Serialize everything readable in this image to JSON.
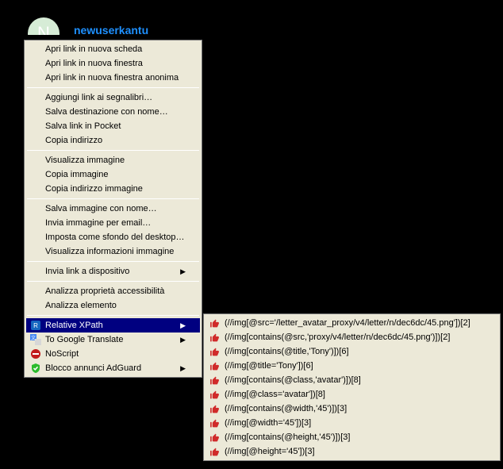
{
  "header": {
    "avatar_letter": "N",
    "username": "newuserkantu"
  },
  "menu": {
    "group1": [
      "Apri link in nuova scheda",
      "Apri link in nuova finestra",
      "Apri link in nuova finestra anonima"
    ],
    "group2": [
      "Aggiungi link ai segnalibri…",
      "Salva destinazione con nome…",
      "Salva link in Pocket",
      "Copia indirizzo"
    ],
    "group3": [
      "Visualizza immagine",
      "Copia immagine",
      "Copia indirizzo immagine"
    ],
    "group4": [
      "Salva immagine con nome…",
      "Invia immagine per email…",
      "Imposta come sfondo del desktop…",
      "Visualizza informazioni immagine"
    ],
    "group5_sub": "Invia link a dispositivo",
    "group6": [
      "Analizza proprietà accessibilità",
      "Analizza elemento"
    ],
    "ext": {
      "relxpath": "Relative XPath",
      "gtranslate": "To Google Translate",
      "noscript": "NoScript",
      "adguard": "Blocco annunci AdGuard"
    }
  },
  "submenu": [
    "(//img[@src='/letter_avatar_proxy/v4/letter/n/dec6dc/45.png'])[2]",
    "(//img[contains(@src,'proxy/v4/letter/n/dec6dc/45.png')])[2]",
    "(//img[contains(@title,'Tony')])[6]",
    "(//img[@title='Tony'])[6]",
    "(//img[contains(@class,'avatar')])[8]",
    "(//img[@class='avatar'])[8]",
    "(//img[contains(@width,'45')])[3]",
    "(//img[@width='45'])[3]",
    "(//img[contains(@height,'45')])[3]",
    "(//img[@height='45'])[3]"
  ]
}
